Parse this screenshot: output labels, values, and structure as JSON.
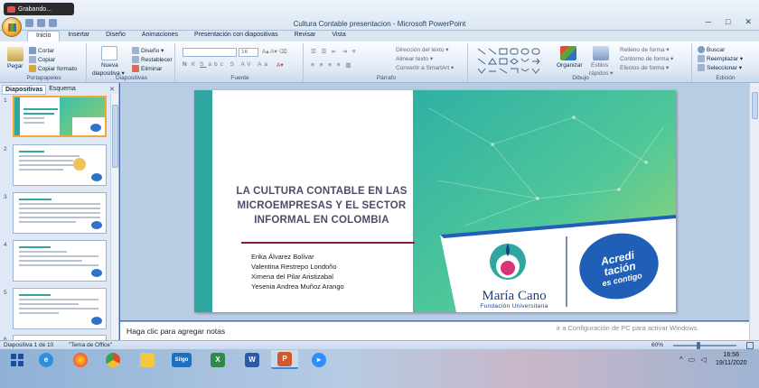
{
  "recording": {
    "label": "Grabando..."
  },
  "window": {
    "title": "Cultura Contable presentacion - Microsoft PowerPoint",
    "minimize": "─",
    "maximize": "□",
    "close": "✕"
  },
  "ribbon": {
    "tabs": [
      "Inicio",
      "Insertar",
      "Diseño",
      "Animaciones",
      "Presentación con diapositivas",
      "Revisar",
      "Vista"
    ],
    "active_tab": "Inicio",
    "clipboard": {
      "label": "Portapapeles",
      "paste": "Pegar",
      "cut": "Cortar",
      "copy": "Copiar",
      "format_painter": "Copiar formato"
    },
    "slides": {
      "label": "Diapositivas",
      "new_slide_1": "Nueva",
      "new_slide_2": "diapositiva ▾",
      "layout": "Diseño ▾",
      "reset": "Restablecer",
      "delete": "Eliminar"
    },
    "font": {
      "label": "Fuente",
      "size": "16"
    },
    "paragraph": {
      "label": "Párrafo",
      "text_direction": "Dirección del texto ▾",
      "align_text": "Alinear texto ▾",
      "smartart": "Convertir a SmartArt ▾"
    },
    "drawing": {
      "label": "Dibujo",
      "arrange": "Organizar",
      "quick_styles_1": "Estilos",
      "quick_styles_2": "rápidos ▾",
      "shape_fill": "Relleno de forma ▾",
      "shape_outline": "Contorno de forma ▾",
      "shape_effects": "Efectos de forma ▾"
    },
    "editing": {
      "label": "Edición",
      "find": "Buscar",
      "replace": "Reemplazar ▾",
      "select": "Seleccionar ▾"
    }
  },
  "left_pane": {
    "tabs": [
      "Diapositivas",
      "Esquema"
    ],
    "close": "✕",
    "slide_numbers": [
      "1",
      "2",
      "3",
      "4",
      "5",
      "6"
    ]
  },
  "slide": {
    "title": "LA CULTURA CONTABLE EN LAS MICROEMPRESAS Y EL SECTOR INFORMAL EN COLOMBIA",
    "authors": [
      "Erika Álvarez Bolívar",
      "Valentina Restrepo Londoño",
      "Ximena del Pilar Aristizabal",
      "Yesenia Andrea Muñoz Arango"
    ],
    "logo_name": "María Cano",
    "logo_subtitle": "Fundación Universitaria",
    "badge_line1": "Acredi",
    "badge_line2": "tación",
    "badge_line3": "es contigo"
  },
  "notes": {
    "placeholder": "Haga clic para agregar notas"
  },
  "activation": {
    "text": "ir a Configuración de PC para activar Windows."
  },
  "status": {
    "slide_info": "Diapositiva 1 de 10",
    "theme": "\"Tema de Office\"",
    "zoom": "60%"
  },
  "taskbar": {
    "time": "16:56",
    "date": "19/11/2020",
    "apps": [
      "windows-start",
      "internet-explorer",
      "firefox",
      "chrome",
      "file-explorer",
      "siigo",
      "excel",
      "word",
      "powerpoint",
      "zoom"
    ],
    "siigo_label": "Siigo"
  },
  "colors": {
    "accent_teal": "#2fa7a0",
    "title_color": "#4a4e6a",
    "rule_color": "#8b1a3e",
    "logo_blue": "#1e3f82",
    "badge_blue": "#1f5fb8"
  }
}
